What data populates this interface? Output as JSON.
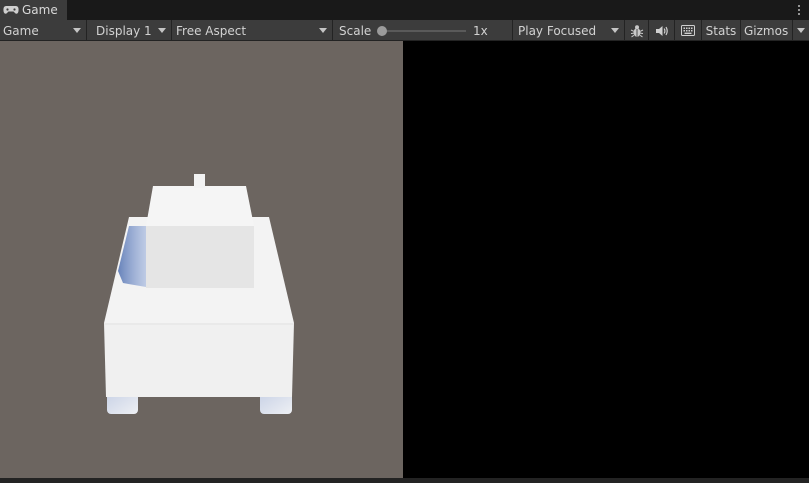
{
  "tab": {
    "label": "Game",
    "icon": "gamepad-icon"
  },
  "toolbar": {
    "mode": "Game",
    "display": "Display 1",
    "aspect": "Free Aspect",
    "scale_label": "Scale",
    "scale_value": "1x",
    "scale_slider_level": 0,
    "play_mode": "Play Focused",
    "stats_label": "Stats",
    "gizmos_label": "Gizmos"
  },
  "icons": {
    "bug": "bug-icon",
    "audio": "speaker-icon",
    "keyboard": "keyboard-icon",
    "menu": "kebab-menu-icon"
  },
  "colors": {
    "viewport_background": "#6c6560",
    "black_pane": "#000000",
    "toolbar": "#3c3c3c",
    "tank_body": "#f2f2f2",
    "tank_shadow": "#5a7ab8"
  }
}
